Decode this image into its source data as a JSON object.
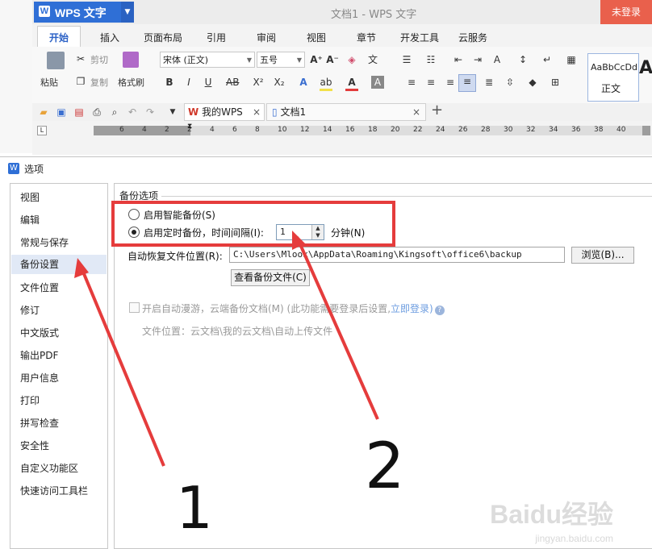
{
  "app": {
    "logo_mark": "W",
    "logo_text": "WPS 文字",
    "doc_title": "文档1 - WPS 文字",
    "login_label": "未登录"
  },
  "menu": {
    "tabs": [
      "开始",
      "插入",
      "页面布局",
      "引用",
      "审阅",
      "视图",
      "章节",
      "开发工具",
      "云服务"
    ],
    "active": "开始"
  },
  "ribbon": {
    "paste": "粘贴",
    "cut": "剪切",
    "copy": "复制",
    "format_painter": "格式刷",
    "font_name": "宋体 (正文)",
    "font_size": "五号",
    "style_sample": "AaBbCcDd",
    "style_name": "正文",
    "style_sample2": "A"
  },
  "doc_tabs": {
    "home": "我的WPS",
    "doc": "文档1",
    "new_tab": "+"
  },
  "ruler": {
    "ticks": [
      "6",
      "4",
      "2",
      "2",
      "4",
      "6",
      "8",
      "10",
      "12",
      "14",
      "16",
      "18",
      "20",
      "22",
      "24",
      "26",
      "28",
      "30",
      "32",
      "34",
      "36",
      "38",
      "40"
    ]
  },
  "dialog": {
    "icon": "W",
    "title": "选项",
    "sidebar": [
      "视图",
      "编辑",
      "常规与保存",
      "备份设置",
      "文件位置",
      "修订",
      "中文版式",
      "输出PDF",
      "用户信息",
      "打印",
      "拼写检查",
      "安全性",
      "自定义功能区",
      "快速访问工具栏"
    ],
    "selected": "备份设置",
    "group_title": "备份选项",
    "smart_backup": "启用智能备份(S)",
    "timed_backup": "启用定时备份，时间间隔(I):",
    "interval_value": "1",
    "interval_unit": "分钟(N)",
    "recover_label": "自动恢复文件位置(R):",
    "recover_path": "C:\\Users\\Mlook\\AppData\\Roaming\\Kingsoft\\office6\\backup",
    "browse_button": "浏览(B)...",
    "view_backup_button": "查看备份文件(C)",
    "cloud_roam": "开启自动漫游，云端备份文档(M) (此功能需要登录后设置,",
    "cloud_login_link": "立即登录)",
    "cloud_location": "文件位置：云文档\\我的云文档\\自动上传文件"
  },
  "annotations": {
    "mark1": "1",
    "mark2": "2",
    "arrow_color": "#e53c3c",
    "box_color": "#e53c3c"
  },
  "watermark": {
    "brand": "Baidu经验",
    "url": "jingyan.baidu.com"
  }
}
